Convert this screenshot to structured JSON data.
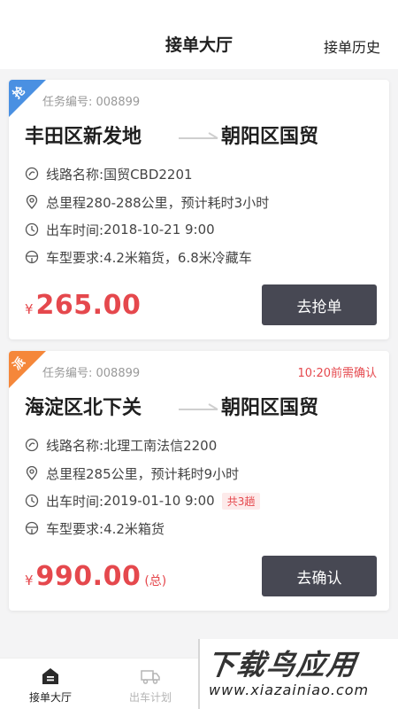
{
  "header": {
    "title": "接单大厅",
    "history_link": "接单历史"
  },
  "colors": {
    "accent_red": "#e5484d",
    "button_dark": "#474853",
    "badge_blue": "#4a90e2",
    "badge_orange": "#f5873a"
  },
  "labels": {
    "route_name": "线路名称: ",
    "departure": "出车时间: ",
    "vehicle": "车型要求: "
  },
  "orders": [
    {
      "badge": "抢",
      "badge_color": "#4a90e2",
      "task_no": "任务编号: 008899",
      "deadline": "",
      "from": "丰田区新发地",
      "to": "朝阳区国贸",
      "route_name": "国贸CBD2201",
      "distance": "总里程280-288公里，预计耗时3小时",
      "departure_time": "2018-10-21 9:00",
      "trips": "",
      "vehicle": "4.2米箱货，6.8米冷藏车",
      "currency": "¥",
      "price": "265.00",
      "price_note": "",
      "action": "去抢单"
    },
    {
      "badge": "派",
      "badge_color": "#f5873a",
      "task_no": "任务编号: 008899",
      "deadline": "10:20前需确认",
      "from": "海淀区北下关",
      "to": "朝阳区国贸",
      "route_name": "北理工南法信2200",
      "distance": "总里程285公里，预计耗时9小时",
      "departure_time": "2019-01-10 9:00",
      "trips": "共3趟",
      "vehicle": "4.2米箱货",
      "currency": "¥",
      "price": "990.00",
      "price_note": "(总)",
      "action": "去确认"
    }
  ],
  "tabbar": {
    "items": [
      {
        "label": "接单大厅",
        "icon": "hall-icon",
        "active": true
      },
      {
        "label": "出车计划",
        "icon": "truck-icon",
        "active": false
      }
    ]
  },
  "watermark": {
    "main": "下载鸟应用",
    "sub": "www.xiazainiao.com"
  }
}
